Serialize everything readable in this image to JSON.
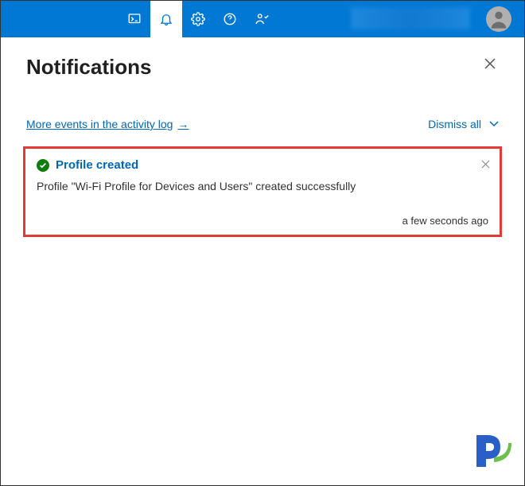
{
  "header": {
    "title": "Notifications"
  },
  "actions": {
    "activity_log_link": "More events in the activity log",
    "dismiss_all": "Dismiss all"
  },
  "notifications": [
    {
      "title": "Profile created",
      "message": "Profile \"Wi-Fi Profile for Devices and Users\" created successfully",
      "timestamp": "a few seconds ago",
      "status": "success"
    }
  ]
}
